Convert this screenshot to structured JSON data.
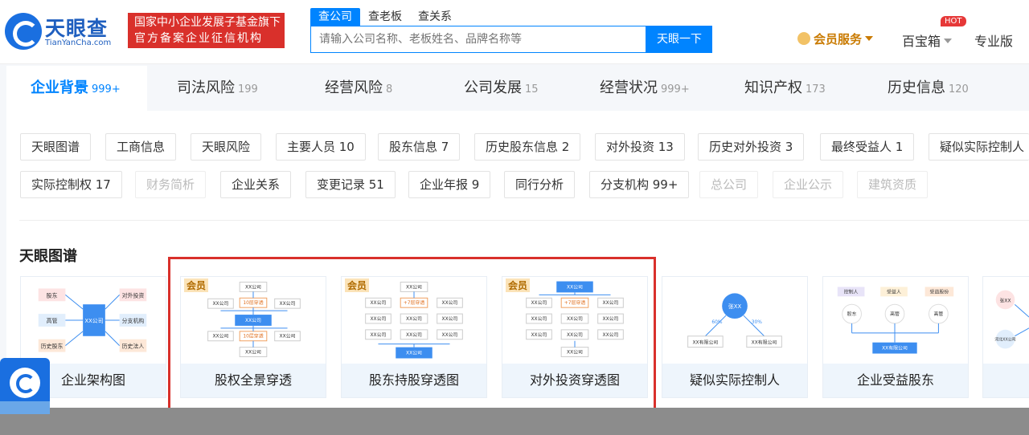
{
  "header": {
    "logo_cn": "天眼查",
    "logo_en": "TianYanCha.com",
    "slogan_line1": "国家中小企业发展子基金旗下",
    "slogan_line2": "官方备案企业征信机构",
    "search_tabs": [
      "查公司",
      "查老板",
      "查关系"
    ],
    "search_placeholder": "请输入公司名称、老板姓名、品牌名称等",
    "search_button": "天眼一下",
    "vip_label": "会员服务",
    "baobox_label": "百宝箱",
    "hot_badge": "HOT",
    "pro_label": "专业版"
  },
  "main_tabs": [
    {
      "label": "企业背景",
      "count": "999+"
    },
    {
      "label": "司法风险",
      "count": "199"
    },
    {
      "label": "经营风险",
      "count": "8"
    },
    {
      "label": "公司发展",
      "count": "15"
    },
    {
      "label": "经营状况",
      "count": "999+"
    },
    {
      "label": "知识产权",
      "count": "173"
    },
    {
      "label": "历史信息",
      "count": "120"
    }
  ],
  "chips_row1": [
    "天眼图谱",
    "工商信息",
    "天眼风险",
    "主要人员 10",
    "股东信息 7",
    "历史股东信息 2",
    "对外投资 13",
    "历史对外投资 3",
    "最终受益人 1",
    "疑似实际控制人"
  ],
  "chips_row2": [
    "实际控制权 17",
    "财务简析",
    "企业关系",
    "变更记录 51",
    "企业年报 9",
    "同行分析",
    "分支机构 99+",
    "总公司",
    "企业公示",
    "建筑资质"
  ],
  "section_title": "天眼图谱",
  "vip_badge": "会员",
  "cards": [
    {
      "label": "企业架构图"
    },
    {
      "label": "股权全景穿透"
    },
    {
      "label": "股东持股穿透图"
    },
    {
      "label": "对外投资穿透图"
    },
    {
      "label": "疑似实际控制人"
    },
    {
      "label": "企业受益股东"
    }
  ],
  "diagram_text": {
    "card1": {
      "center": "XX公司",
      "left": [
        "股东",
        "高管",
        "历史股东"
      ],
      "right": [
        "对外投资",
        "分支机构",
        "历史法人"
      ]
    },
    "company": "XX公司",
    "pen10": "10层穿透",
    "pen7": "+7层穿透",
    "ltd": "XX有限公司",
    "zhang": "张XX",
    "pct1": "60%",
    "pct2": "30%",
    "card6_top": [
      "控制人",
      "受益人",
      "受益股份"
    ],
    "card6_mid": [
      "股东",
      "高管",
      "高管"
    ],
    "card7": {
      "top": "张XX",
      "mid": "河北XX公司"
    }
  },
  "colors": {
    "accent": "#0084ff",
    "brand": "#1f5fbf",
    "red": "#d9302b"
  }
}
